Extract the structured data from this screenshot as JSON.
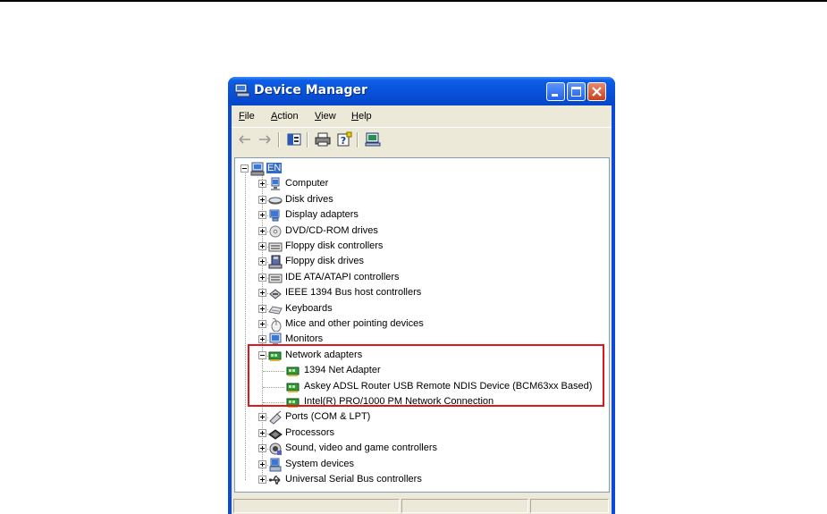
{
  "window": {
    "title": "Device Manager"
  },
  "menu": [
    {
      "label": "File",
      "accel": "F",
      "rest": "ile"
    },
    {
      "label": "Action",
      "accel": "A",
      "rest": "ction"
    },
    {
      "label": "View",
      "accel": "V",
      "rest": "iew"
    },
    {
      "label": "Help",
      "accel": "H",
      "rest": "elp"
    }
  ],
  "toolbar": [
    "back-arrow-icon",
    "forward-arrow-icon",
    "show-hide-console-tree-icon",
    "print-icon",
    "help-icon",
    "scan-hardware-icon"
  ],
  "tree": {
    "root": "EN",
    "categories": [
      {
        "label": "Computer",
        "icon": "computer-icon"
      },
      {
        "label": "Disk drives",
        "icon": "disk-drive-icon"
      },
      {
        "label": "Display adapters",
        "icon": "display-adapter-icon"
      },
      {
        "label": "DVD/CD-ROM drives",
        "icon": "cd-drive-icon"
      },
      {
        "label": "Floppy disk controllers",
        "icon": "controller-icon"
      },
      {
        "label": "Floppy disk drives",
        "icon": "floppy-drive-icon"
      },
      {
        "label": "IDE ATA/ATAPI controllers",
        "icon": "controller-icon"
      },
      {
        "label": "IEEE 1394 Bus host controllers",
        "icon": "ieee1394-icon"
      },
      {
        "label": "Keyboards",
        "icon": "keyboard-icon"
      },
      {
        "label": "Mice and other pointing devices",
        "icon": "mouse-icon"
      },
      {
        "label": "Monitors",
        "icon": "monitor-icon"
      },
      {
        "label": "Network adapters",
        "icon": "network-card-icon",
        "expanded": true,
        "children": [
          {
            "label": "1394 Net Adapter"
          },
          {
            "label": "Askey ADSL Router USB Remote NDIS Device (BCM63xx Based)"
          },
          {
            "label": "Intel(R) PRO/1000 PM Network Connection"
          }
        ]
      },
      {
        "label": "Ports (COM & LPT)",
        "icon": "port-icon"
      },
      {
        "label": "Processors",
        "icon": "processor-icon"
      },
      {
        "label": "Sound, video and game controllers",
        "icon": "sound-icon"
      },
      {
        "label": "System devices",
        "icon": "system-device-icon"
      },
      {
        "label": "Universal Serial Bus controllers",
        "icon": "usb-icon"
      }
    ]
  },
  "colors": {
    "titlebar": "#0851d8",
    "highlight": "#e0161c",
    "selection": "#316ac5"
  }
}
